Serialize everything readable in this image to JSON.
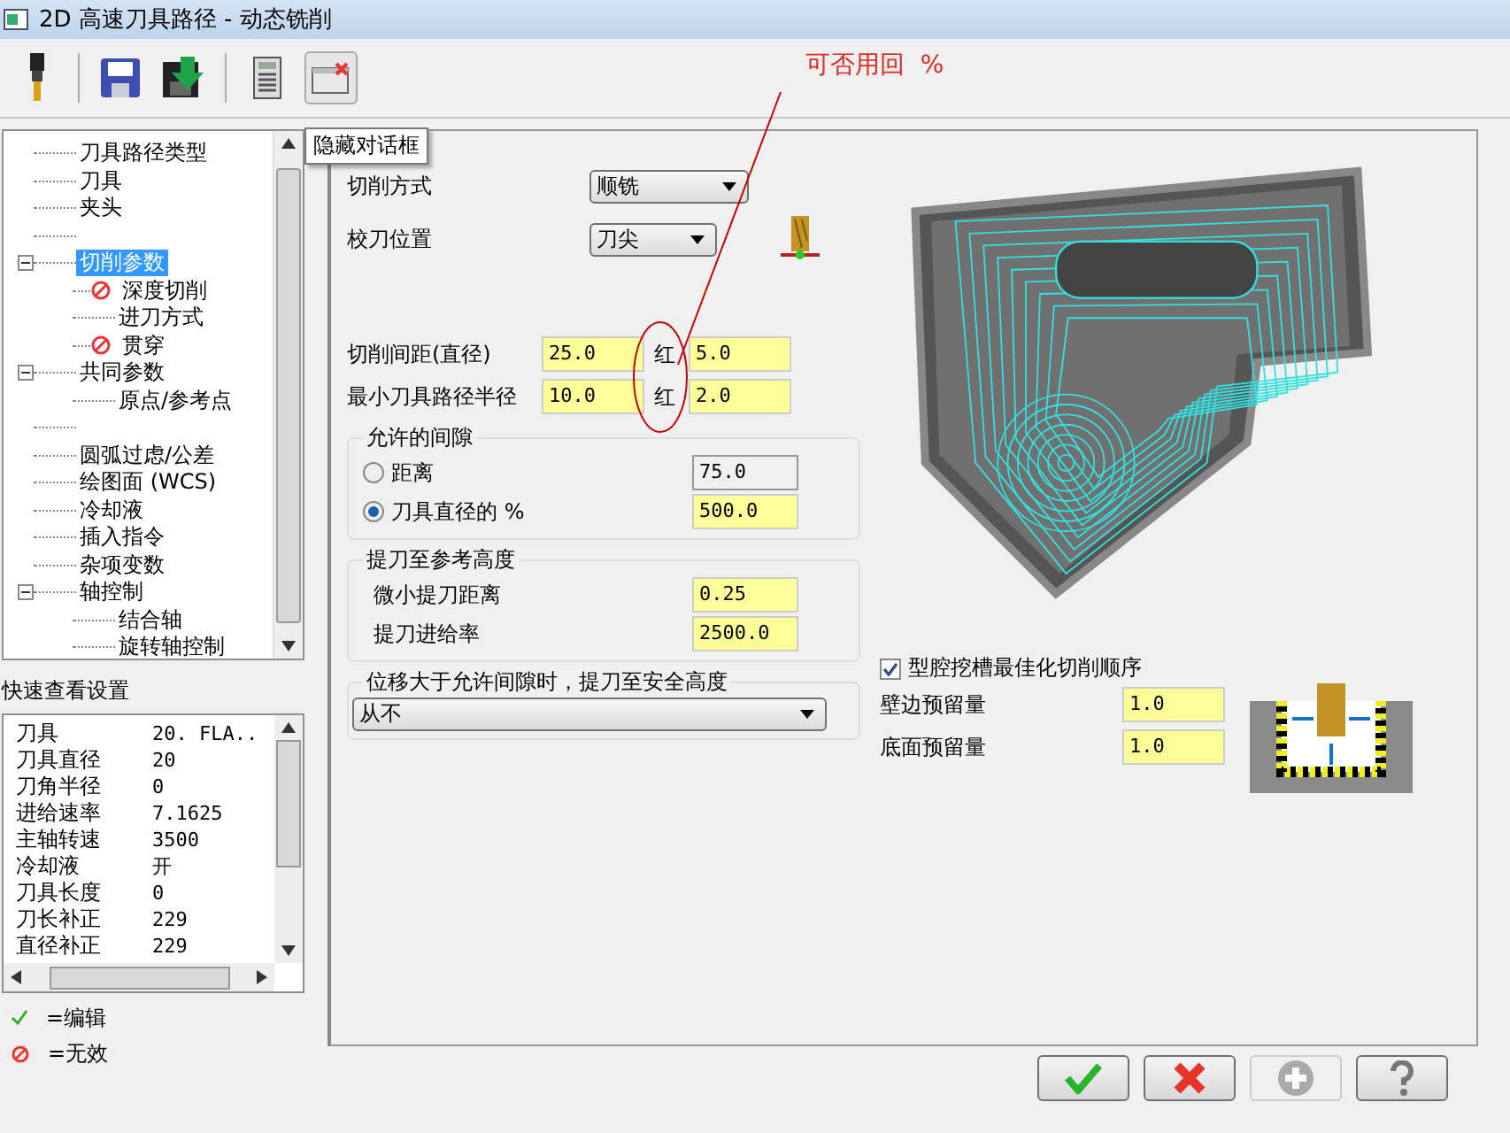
{
  "window": {
    "title": "2D 高速刀具路径 - 动态铣削"
  },
  "tooltip": "隐藏对话框",
  "tree": [
    {
      "kind": "item",
      "label": "刀具路径类型",
      "selected": false,
      "invalid": false
    },
    {
      "kind": "item",
      "label": "刀具",
      "selected": false,
      "invalid": false
    },
    {
      "kind": "item",
      "label": "夹头",
      "selected": false,
      "invalid": false
    },
    {
      "kind": "blank"
    },
    {
      "kind": "item",
      "label": "切削参数",
      "selected": true,
      "invalid": false,
      "expanded": true,
      "children": [
        {
          "kind": "item",
          "label": "深度切削",
          "selected": false,
          "invalid": true
        },
        {
          "kind": "item",
          "label": "进刀方式",
          "selected": false,
          "invalid": false
        },
        {
          "kind": "item",
          "label": "贯穿",
          "selected": false,
          "invalid": true
        }
      ]
    },
    {
      "kind": "item",
      "label": "共同参数",
      "selected": false,
      "invalid": false,
      "expanded": true,
      "children": [
        {
          "kind": "item",
          "label": "原点/参考点",
          "selected": false,
          "invalid": false
        }
      ]
    },
    {
      "kind": "blank"
    },
    {
      "kind": "item",
      "label": "圆弧过虑/公差",
      "selected": false,
      "invalid": false
    },
    {
      "kind": "item",
      "label": "绘图面 (WCS)",
      "selected": false,
      "invalid": false
    },
    {
      "kind": "item",
      "label": "冷却液",
      "selected": false,
      "invalid": false
    },
    {
      "kind": "item",
      "label": "插入指令",
      "selected": false,
      "invalid": false
    },
    {
      "kind": "item",
      "label": "杂项变数",
      "selected": false,
      "invalid": false
    },
    {
      "kind": "item",
      "label": "轴控制",
      "selected": false,
      "invalid": false,
      "expanded": true,
      "children": [
        {
          "kind": "item",
          "label": "结合轴",
          "selected": false,
          "invalid": false
        },
        {
          "kind": "item",
          "label": "旋转轴控制",
          "selected": false,
          "invalid": false
        }
      ]
    }
  ],
  "quick_view": {
    "title": "快速查看设置",
    "rows": [
      {
        "name": "刀具",
        "value": "20. FLA.."
      },
      {
        "name": "刀具直径",
        "value": "20"
      },
      {
        "name": "刀角半径",
        "value": "0"
      },
      {
        "name": "进给速率",
        "value": "7.1625"
      },
      {
        "name": "主轴转速",
        "value": "3500"
      },
      {
        "name": "冷却液",
        "value": "开"
      },
      {
        "name": "刀具长度",
        "value": "0"
      },
      {
        "name": "刀长补正",
        "value": "229"
      },
      {
        "name": "直径补正",
        "value": "229"
      }
    ]
  },
  "legend": [
    {
      "kind": "edit",
      "text": "=编辑"
    },
    {
      "kind": "invalid",
      "text": "=无效"
    }
  ],
  "form": {
    "cut_method": {
      "label": "切削方式",
      "value": "顺铣"
    },
    "tool_position": {
      "label": "校刀位置",
      "value": "刀尖"
    },
    "pairs": [
      {
        "label": "切削间距(直径)",
        "value": "25.0",
        "unit": "红",
        "value_2": "5.0"
      },
      {
        "label": "最小刀具路径半径",
        "value": "10.0",
        "unit": "红",
        "value_2": "2.0"
      }
    ],
    "clearance": {
      "title": "允许的间隙",
      "options": [
        {
          "label": "距离",
          "selected": false,
          "value": "75.0",
          "disabled": true
        },
        {
          "label": "刀具直径的 %",
          "selected": true,
          "value": "500.0",
          "disabled": false
        }
      ]
    },
    "retract": {
      "title": "提刀至参考高度",
      "fields": [
        {
          "label": "微小提刀距离",
          "value": "0.25"
        },
        {
          "label": "提刀进给率",
          "value": "2500.0"
        }
      ]
    },
    "safety": {
      "title": "位移大于允许间隙时，提刀至安全高度",
      "value": "从不"
    },
    "pocket_order": {
      "label": "型腔挖槽最佳化切削顺序",
      "checked": true
    },
    "stock": [
      {
        "label": "壁边预留量",
        "value": "1.0"
      },
      {
        "label": "底面预留量",
        "value": "1.0"
      }
    ]
  },
  "annotation": {
    "text": "可否用回  %"
  }
}
